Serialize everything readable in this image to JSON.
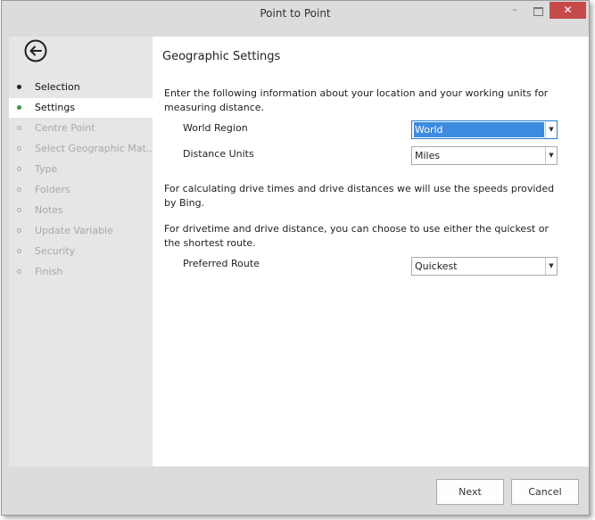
{
  "window": {
    "title": "Point to Point",
    "controls": {
      "minimize": "–",
      "close": "✕"
    }
  },
  "sidebar": {
    "back_icon": "arrow-left-circle-icon",
    "items": [
      {
        "label": "Selection",
        "state": "done"
      },
      {
        "label": "Settings",
        "state": "active"
      },
      {
        "label": "Centre Point",
        "state": "todo"
      },
      {
        "label": "Select Geographic Mat...",
        "state": "todo"
      },
      {
        "label": "Type",
        "state": "todo"
      },
      {
        "label": "Folders",
        "state": "todo"
      },
      {
        "label": "Notes",
        "state": "todo"
      },
      {
        "label": "Update Variable",
        "state": "todo"
      },
      {
        "label": "Security",
        "state": "todo"
      },
      {
        "label": "Finish",
        "state": "todo"
      }
    ]
  },
  "main": {
    "heading": "Geographic Settings",
    "intro": "Enter the following information about your location and your working units for measuring distance.",
    "world_region": {
      "label": "World Region",
      "value": "World"
    },
    "distance_units": {
      "label": "Distance Units",
      "value": "Miles"
    },
    "drive_info": "For calculating drive times and drive distances we will use the speeds provided by Bing.",
    "route_info": "For drivetime and drive distance, you can choose to use either the quickest or the shortest route.",
    "preferred_route": {
      "label": "Preferred Route",
      "value": "Quickest"
    }
  },
  "footer": {
    "next_label": "Next",
    "cancel_label": "Cancel"
  },
  "colors": {
    "active_bullet": "#2e9d3e",
    "close_button": "#c74a4a",
    "focus_highlight": "#3b8ce0"
  }
}
